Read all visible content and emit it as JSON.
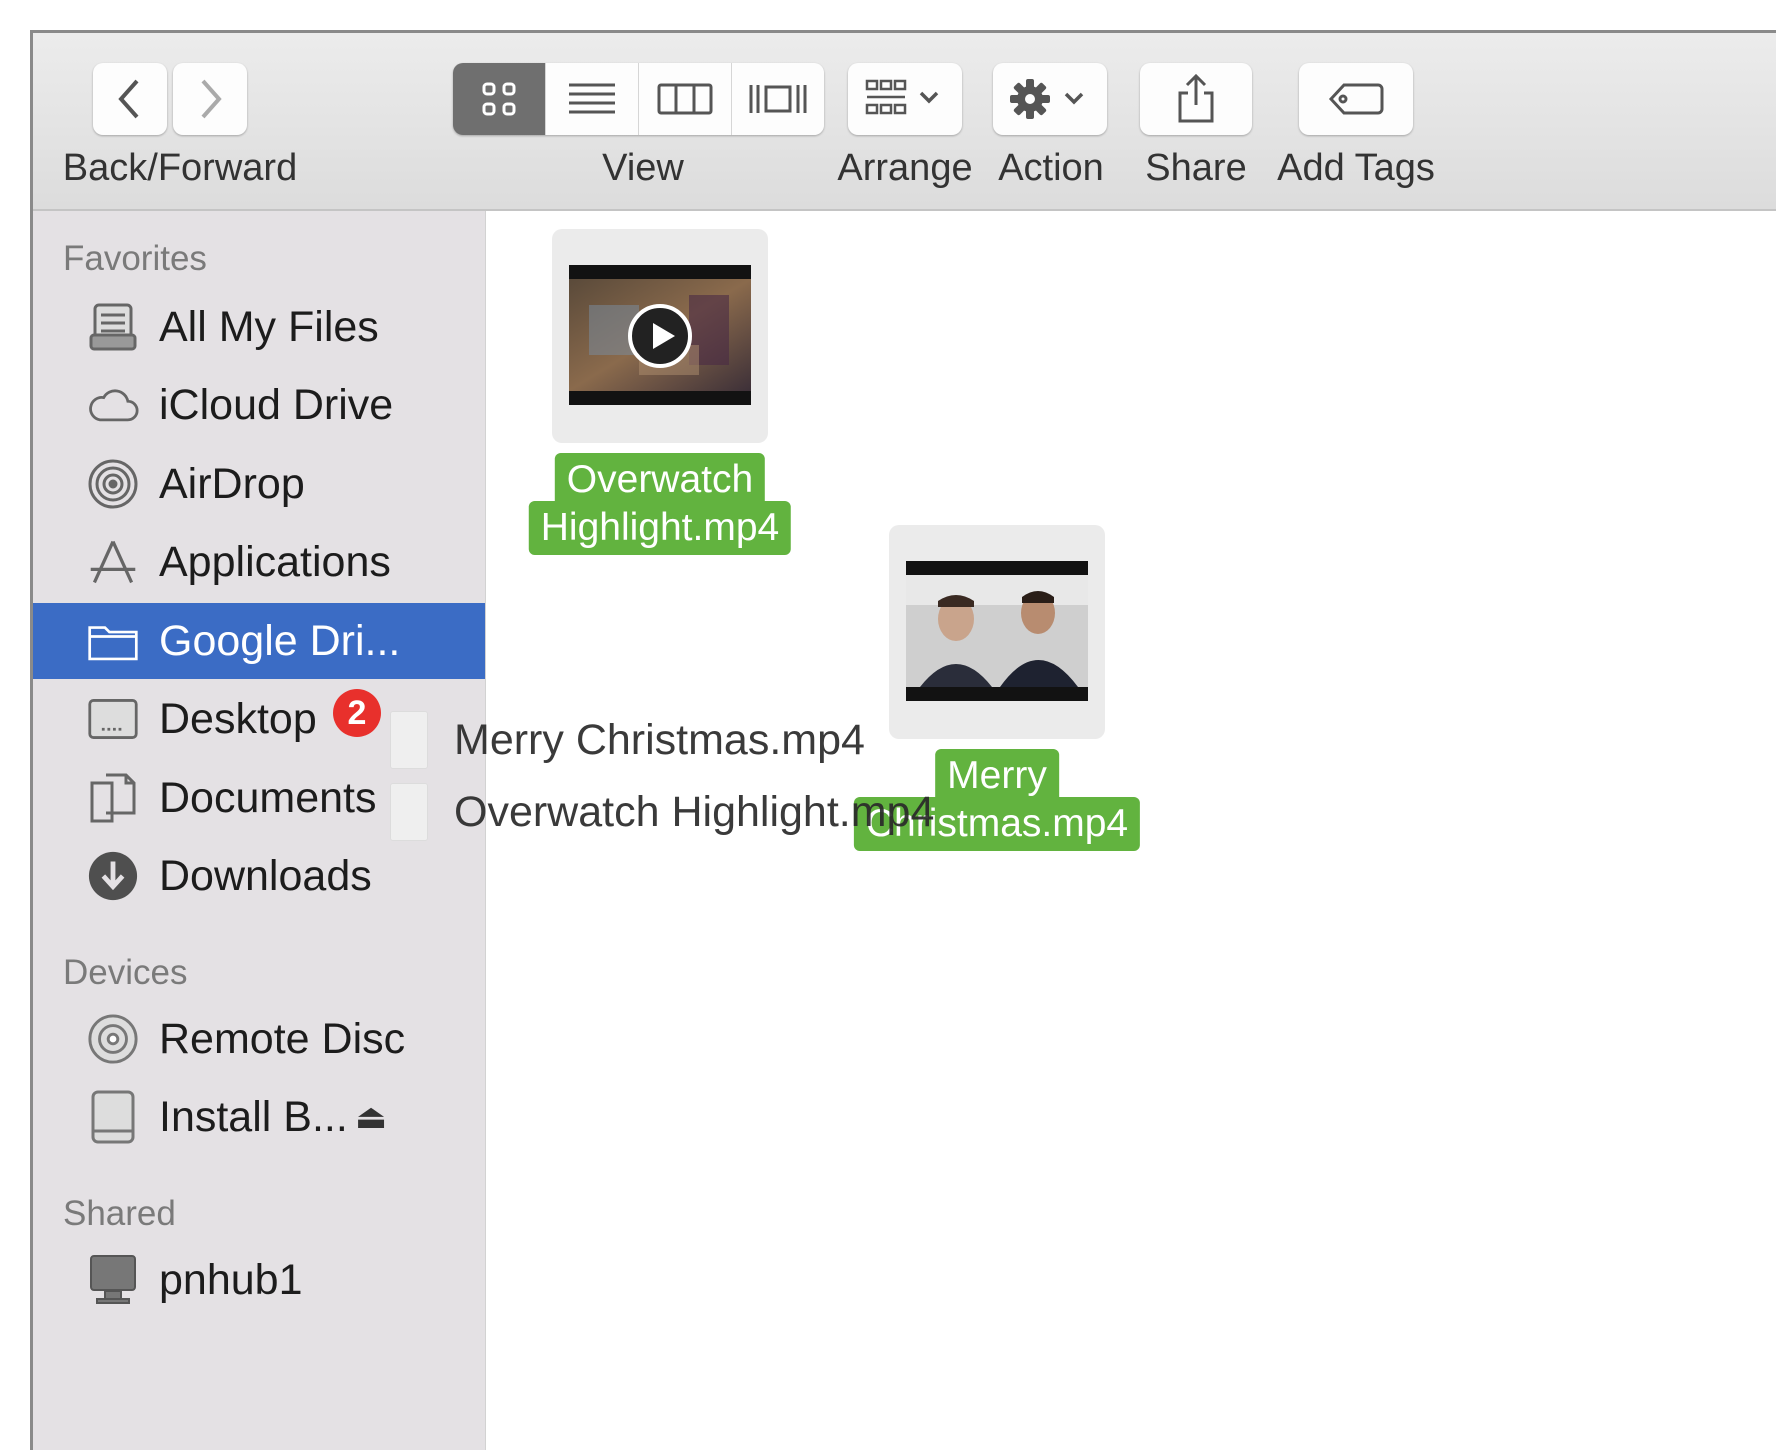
{
  "toolbar": {
    "back_forward_label": "Back/Forward",
    "view_label": "View",
    "arrange_label": "Arrange",
    "action_label": "Action",
    "share_label": "Share",
    "add_tags_label": "Add Tags",
    "active_view": "icon",
    "icons": {
      "back": "chevron-left-icon",
      "forward": "chevron-right-icon",
      "views": [
        "icon-view-icon",
        "list-view-icon",
        "column-view-icon",
        "cover-flow-icon"
      ],
      "arrange": "arrange-grid-icon",
      "action": "gear-icon",
      "share": "share-icon",
      "tags": "tag-icon"
    }
  },
  "sidebar": {
    "favorites_title": "Favorites",
    "favorites": [
      {
        "label": "All My Files",
        "icon": "all-files-icon"
      },
      {
        "label": "iCloud Drive",
        "icon": "cloud-icon"
      },
      {
        "label": "AirDrop",
        "icon": "airdrop-icon"
      },
      {
        "label": "Applications",
        "icon": "applications-icon"
      },
      {
        "label": "Google Dri...",
        "icon": "folder-icon",
        "selected": true
      },
      {
        "label": "Desktop",
        "icon": "desktop-icon",
        "badge": "2"
      },
      {
        "label": "Documents",
        "icon": "documents-icon"
      },
      {
        "label": "Downloads",
        "icon": "downloads-icon"
      }
    ],
    "devices_title": "Devices",
    "devices": [
      {
        "label": "Remote Disc",
        "icon": "disc-icon"
      },
      {
        "label": "Install B...",
        "icon": "drive-icon",
        "eject": "⏏"
      }
    ],
    "shared_title": "Shared",
    "shared": [
      {
        "label": "pnhub1",
        "icon": "computer-icon"
      }
    ]
  },
  "content": {
    "files": [
      {
        "name_line1": "Overwatch",
        "name_line2": "Highlight.mp4"
      },
      {
        "name_line1": "Merry",
        "name_line2": "Christmas.mp4"
      }
    ],
    "drag_items": [
      "Merry Christmas.mp4",
      "Overwatch Highlight.mp4"
    ]
  },
  "colors": {
    "selection_blue": "#3b6cc5",
    "tag_green": "#62b33f",
    "badge_red": "#e8302c",
    "sidebar_bg": "#e4e1e4"
  }
}
